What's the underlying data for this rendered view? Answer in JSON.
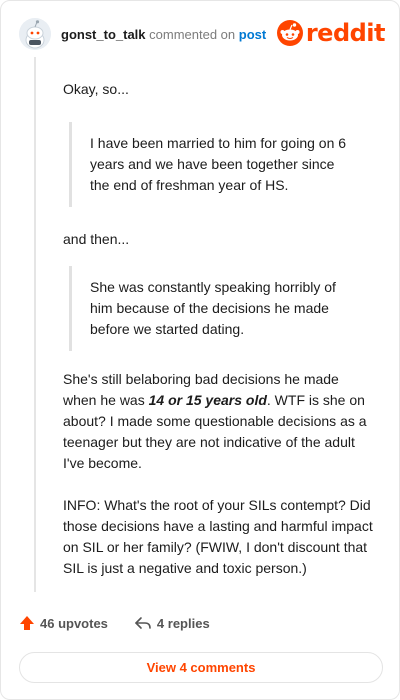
{
  "header": {
    "username": "gonst_to_talk",
    "action": "commented on",
    "target": "post",
    "logo_text": "reddit",
    "brand_color": "#ff4500"
  },
  "comment": {
    "p1": "Okay, so...",
    "quote1": "I have been married to him for going on 6 years and we have been together since the end of freshman year of HS.",
    "p2": "and then...",
    "quote2": "She was constantly speaking horribly of him because of the decisions he made before we started dating.",
    "p3_before": "She's still belaboring bad decisions he made when he was ",
    "p3_emph": "14 or 15 years old",
    "p3_after": ". WTF is she on about? I made some questionable decisions as a teenager but they are not indicative of the adult I've become.",
    "p4": "INFO: What's the root of your SILs contempt? Did those decisions have a lasting and harmful impact on SIL or her family? (FWIW, I don't discount that SIL is just a negative and toxic person.)"
  },
  "footer": {
    "upvotes": "46 upvotes",
    "replies": "4 replies",
    "view_comments": "View 4 comments",
    "upvote_icon": "upvote-arrow-icon",
    "reply_icon": "reply-arrow-icon"
  }
}
